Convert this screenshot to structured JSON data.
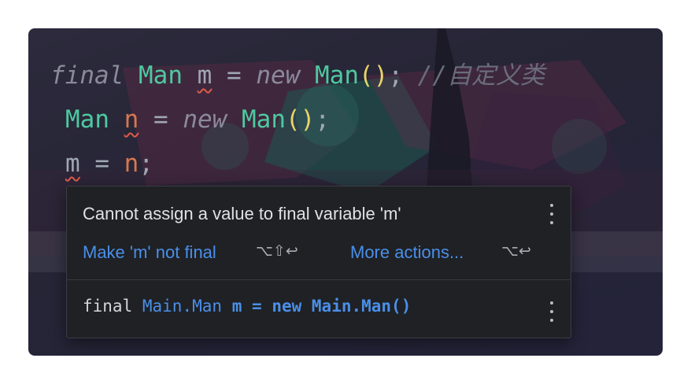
{
  "code": {
    "line1": {
      "kw_final": "final",
      "type": "Man",
      "var": "m",
      "op_assign": " = ",
      "kw_new": "new",
      "ctor": "Man",
      "parens": "()",
      "semicolon": ";",
      "comment": "//自定义类"
    },
    "line2": {
      "type": "Man",
      "var": "n",
      "op_assign": " = ",
      "kw_new": "new",
      "ctor": "Man",
      "parens": "()",
      "semicolon": ";"
    },
    "line3": {
      "var": "m",
      "op_assign": " = ",
      "value": "n",
      "semicolon": ";"
    }
  },
  "popup": {
    "message": "Cannot assign a value to final variable 'm'",
    "primary_action": "Make 'm' not final",
    "primary_shortcut": "⌥⇧↩",
    "more_actions": "More actions...",
    "more_shortcut": "⌥↩",
    "declaration": {
      "modifier": "final",
      "type": "Main.Man",
      "name": "m",
      "assign": "=",
      "kw_new": "new",
      "ctor": "Main.Man()"
    }
  },
  "colors": {
    "keyword_italic": "#8b8a9a",
    "type": "#4ec9a0",
    "variable_error": "#d9764f",
    "parens": "#e8d36a",
    "link": "#4a8fe8",
    "popup_bg": "#1f2125"
  },
  "icons": {
    "message_menu": "kebab-icon",
    "declaration_menu": "kebab-icon"
  }
}
